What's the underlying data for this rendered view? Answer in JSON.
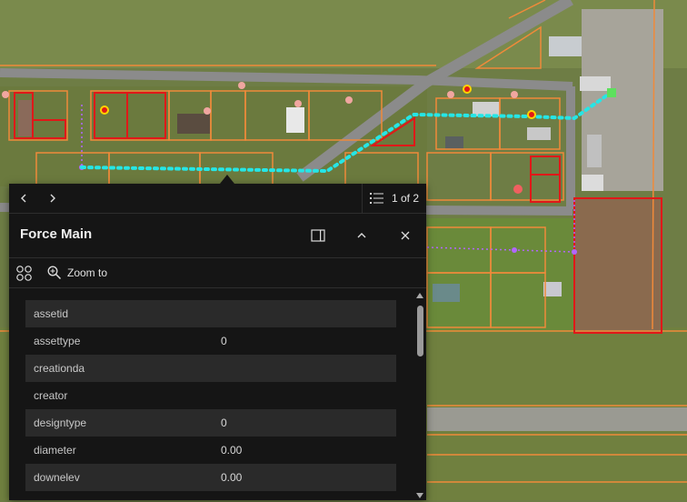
{
  "map": {
    "colors": {
      "parcel": "#f08a3a",
      "highlight": "#e01818",
      "force_main": "#25e6e6",
      "lateral": "#b266ff",
      "road": "#8b8b8b"
    }
  },
  "popup": {
    "pager_text": "1 of 2",
    "title": "Force Main",
    "zoom_label": "Zoom to",
    "icons": {
      "prev": "chevron-left-icon",
      "next": "chevron-right-icon",
      "list": "list-icon",
      "dock": "dock-icon",
      "collapse": "chevron-up-icon",
      "close": "close-icon",
      "related": "related-records-icon",
      "zoom": "zoom-in-icon"
    },
    "fields": [
      {
        "name": "assetid",
        "value": ""
      },
      {
        "name": "assettype",
        "value": "0"
      },
      {
        "name": "creationda",
        "value": ""
      },
      {
        "name": "creator",
        "value": ""
      },
      {
        "name": "designtype",
        "value": "0"
      },
      {
        "name": "diameter",
        "value": "0.00"
      },
      {
        "name": "downelev",
        "value": "0.00"
      }
    ]
  }
}
